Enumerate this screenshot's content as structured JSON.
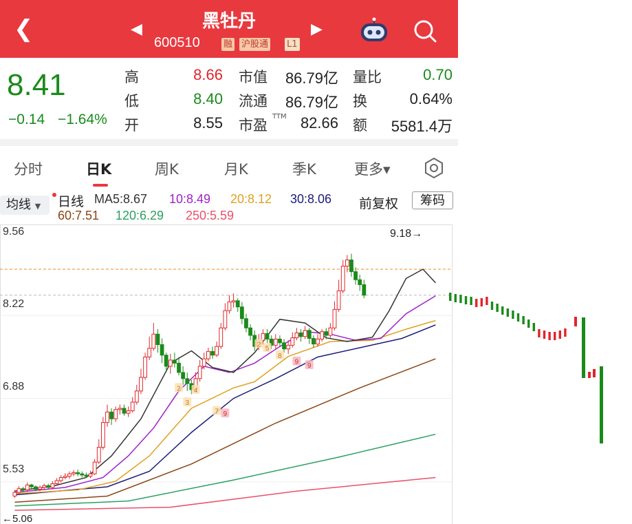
{
  "header": {
    "back_icon": "chevron-left-icon",
    "stock_name": "黑牡丹",
    "stock_code": "600510",
    "badges": [
      "融",
      "沪股通",
      "L1"
    ],
    "prev_icon": "triangle-left-icon",
    "next_icon": "triangle-right-icon",
    "assistant_icon": "robot-icon",
    "search_icon": "search-icon"
  },
  "quote": {
    "price": "8.41",
    "change": "−0.14",
    "change_pct": "−1.64%",
    "high_label": "高",
    "high": "8.66",
    "low_label": "低",
    "low": "8.40",
    "open_label": "开",
    "open": "8.55",
    "mktcap_label": "市值",
    "mktcap": "86.79亿",
    "float_label": "流通",
    "float": "86.79亿",
    "pe_label": "市盈",
    "pe_sup": "TTM",
    "pe": "82.66",
    "volratio_label": "量比",
    "volratio": "0.70",
    "turnover_label": "换",
    "turnover": "0.64%",
    "amount_label": "额",
    "amount": "5581.4万"
  },
  "tabs": [
    "分时",
    "日K",
    "周K",
    "月K",
    "季K",
    "更多▾"
  ],
  "active_tab": "日K",
  "settings_icon": "hexagon-gear-icon",
  "indicators": {
    "selector": "均线",
    "period": "日线",
    "ma5": "MA5:8.67",
    "ma10": "10:8.49",
    "ma20": "20:8.12",
    "ma30": "30:8.06",
    "ma60": "60:7.51",
    "ma120": "120:6.29",
    "ma250": "250:5.59",
    "adjust": "前复权",
    "chips_button": "筹码"
  },
  "colors": {
    "up": "#e0252a",
    "down": "#1a8a1a",
    "ma5": "#333333",
    "ma10": "#a020c8",
    "ma20": "#e0a020",
    "ma30": "#1b1b7a",
    "ma60": "#8b4513",
    "ma120": "#2aa060",
    "ma250": "#e8506a"
  },
  "chart_data": {
    "type": "candlestick",
    "y_ticks": [
      "9.56",
      "8.22",
      "6.88",
      "5.53"
    ],
    "ylim": [
      5.06,
      9.56
    ],
    "period_high": "9.18→",
    "period_low": "←5.06",
    "reference_lines": [
      8.97,
      8.55
    ],
    "candles": [
      [
        5.3,
        5.36,
        5.27,
        5.4
      ],
      [
        5.36,
        5.42,
        5.33,
        5.46
      ],
      [
        5.42,
        5.4,
        5.36,
        5.45
      ],
      [
        5.4,
        5.48,
        5.37,
        5.52
      ],
      [
        5.48,
        5.45,
        5.42,
        5.5
      ],
      [
        5.45,
        5.41,
        5.38,
        5.47
      ],
      [
        5.41,
        5.44,
        5.38,
        5.47
      ],
      [
        5.44,
        5.47,
        5.41,
        5.5
      ],
      [
        5.47,
        5.44,
        5.42,
        5.5
      ],
      [
        5.44,
        5.5,
        5.41,
        5.54
      ],
      [
        5.5,
        5.55,
        5.47,
        5.59
      ],
      [
        5.55,
        5.6,
        5.52,
        5.64
      ],
      [
        5.6,
        5.62,
        5.57,
        5.67
      ],
      [
        5.62,
        5.66,
        5.58,
        5.7
      ],
      [
        5.66,
        5.68,
        5.62,
        5.72
      ],
      [
        5.68,
        5.66,
        5.62,
        5.73
      ],
      [
        5.66,
        5.64,
        5.6,
        5.7
      ],
      [
        5.64,
        5.62,
        5.6,
        5.68
      ],
      [
        5.62,
        5.66,
        5.59,
        5.71
      ],
      [
        5.66,
        5.85,
        5.64,
        5.9
      ],
      [
        5.85,
        6.09,
        5.82,
        6.22
      ],
      [
        6.09,
        6.49,
        6.05,
        6.58
      ],
      [
        6.49,
        6.66,
        6.42,
        6.78
      ],
      [
        6.66,
        6.55,
        6.45,
        6.72
      ],
      [
        6.55,
        6.7,
        6.5,
        6.75
      ],
      [
        6.7,
        6.72,
        6.62,
        6.78
      ],
      [
        6.72,
        6.64,
        6.6,
        6.78
      ],
      [
        6.64,
        6.68,
        6.58,
        6.75
      ],
      [
        6.68,
        6.82,
        6.65,
        6.9
      ],
      [
        6.82,
        7.0,
        6.78,
        7.1
      ],
      [
        7.0,
        7.22,
        6.95,
        7.36
      ],
      [
        7.22,
        7.55,
        7.18,
        7.62
      ],
      [
        7.55,
        7.69,
        7.5,
        7.88
      ],
      [
        7.69,
        7.92,
        7.65,
        8.1
      ],
      [
        7.92,
        7.75,
        7.62,
        8.0
      ],
      [
        7.75,
        7.58,
        7.45,
        7.85
      ],
      [
        7.58,
        7.4,
        7.3,
        7.62
      ],
      [
        7.4,
        7.5,
        7.28,
        7.6
      ],
      [
        7.5,
        7.45,
        7.38,
        7.62
      ],
      [
        7.45,
        7.3,
        7.25,
        7.55
      ],
      [
        7.3,
        7.2,
        7.1,
        7.4
      ],
      [
        7.2,
        7.12,
        7.0,
        7.3
      ],
      [
        7.12,
        7.02,
        6.95,
        7.18
      ],
      [
        7.02,
        7.2,
        6.98,
        7.3
      ],
      [
        7.2,
        7.4,
        7.15,
        7.5
      ],
      [
        7.4,
        7.52,
        7.35,
        7.62
      ],
      [
        7.52,
        7.64,
        7.48,
        7.7
      ],
      [
        7.64,
        7.58,
        7.52,
        7.72
      ],
      [
        7.58,
        7.72,
        7.55,
        7.8
      ],
      [
        7.72,
        8.02,
        7.68,
        8.1
      ],
      [
        8.02,
        8.3,
        7.98,
        8.42
      ],
      [
        8.3,
        8.44,
        8.25,
        8.55
      ],
      [
        8.44,
        8.46,
        8.35,
        8.58
      ],
      [
        8.46,
        8.36,
        8.28,
        8.5
      ],
      [
        8.36,
        8.17,
        8.08,
        8.44
      ],
      [
        8.17,
        8.02,
        7.95,
        8.25
      ],
      [
        8.02,
        7.9,
        7.82,
        8.08
      ],
      [
        7.9,
        7.72,
        7.65,
        7.98
      ],
      [
        7.72,
        7.82,
        7.66,
        7.92
      ],
      [
        7.82,
        7.93,
        7.75,
        8.0
      ],
      [
        7.93,
        7.84,
        7.78,
        8.0
      ],
      [
        7.84,
        7.74,
        7.68,
        7.9
      ],
      [
        7.74,
        7.84,
        7.68,
        7.92
      ],
      [
        7.84,
        7.78,
        7.72,
        7.9
      ],
      [
        7.78,
        7.68,
        7.62,
        7.84
      ],
      [
        7.68,
        7.74,
        7.6,
        7.82
      ],
      [
        7.74,
        7.86,
        7.7,
        7.95
      ],
      [
        7.86,
        7.94,
        7.82,
        8.02
      ],
      [
        7.94,
        7.88,
        7.8,
        8.0
      ],
      [
        7.88,
        7.98,
        7.84,
        8.05
      ],
      [
        7.98,
        7.85,
        7.76,
        8.02
      ],
      [
        7.85,
        7.76,
        7.7,
        7.9
      ],
      [
        7.76,
        7.84,
        7.72,
        7.92
      ],
      [
        7.84,
        7.96,
        7.8,
        8.0
      ],
      [
        7.96,
        7.9,
        7.84,
        8.02
      ],
      [
        7.9,
        8.02,
        7.86,
        8.1
      ],
      [
        8.02,
        8.32,
        7.98,
        8.45
      ],
      [
        8.32,
        8.62,
        8.28,
        8.8
      ],
      [
        8.62,
        9.02,
        8.58,
        9.12
      ],
      [
        9.02,
        9.12,
        8.92,
        9.2
      ],
      [
        9.12,
        8.93,
        8.85,
        9.22
      ],
      [
        8.93,
        8.8,
        8.72,
        9.0
      ],
      [
        8.8,
        8.72,
        8.62,
        8.88
      ],
      [
        8.72,
        8.55,
        8.5,
        8.8
      ]
    ],
    "ma_series": [
      {
        "name": "MA5",
        "points": [
          [
            3,
            5.38
          ],
          [
            12,
            5.46
          ],
          [
            20,
            5.6
          ],
          [
            26,
            5.95
          ],
          [
            33,
            6.55
          ],
          [
            40,
            7.45
          ],
          [
            45,
            7.65
          ],
          [
            50,
            7.38
          ],
          [
            55,
            7.3
          ],
          [
            60,
            7.62
          ],
          [
            66,
            8.16
          ],
          [
            72,
            8.1
          ],
          [
            77,
            7.86
          ],
          [
            82,
            7.8
          ],
          [
            88,
            7.87
          ],
          [
            92,
            8.3
          ],
          [
            96,
            8.82
          ],
          [
            100,
            8.97
          ],
          [
            103,
            8.75
          ]
        ]
      },
      {
        "name": "MA10",
        "points": [
          [
            3,
            5.36
          ],
          [
            15,
            5.44
          ],
          [
            24,
            5.6
          ],
          [
            30,
            5.95
          ],
          [
            36,
            6.4
          ],
          [
            42,
            7.0
          ],
          [
            48,
            7.4
          ],
          [
            54,
            7.3
          ],
          [
            60,
            7.45
          ],
          [
            66,
            7.72
          ],
          [
            72,
            7.96
          ],
          [
            78,
            7.92
          ],
          [
            84,
            7.82
          ],
          [
            90,
            7.85
          ],
          [
            96,
            8.25
          ],
          [
            103,
            8.54
          ]
        ]
      },
      {
        "name": "MA20",
        "points": [
          [
            3,
            5.34
          ],
          [
            18,
            5.4
          ],
          [
            27,
            5.54
          ],
          [
            35,
            5.95
          ],
          [
            45,
            6.72
          ],
          [
            55,
            7.05
          ],
          [
            60,
            7.15
          ],
          [
            68,
            7.56
          ],
          [
            78,
            7.8
          ],
          [
            88,
            7.82
          ],
          [
            96,
            8.0
          ],
          [
            103,
            8.14
          ]
        ]
      },
      {
        "name": "MA30",
        "points": [
          [
            3,
            5.32
          ],
          [
            25,
            5.45
          ],
          [
            35,
            5.7
          ],
          [
            45,
            6.33
          ],
          [
            55,
            6.88
          ],
          [
            65,
            7.2
          ],
          [
            75,
            7.55
          ],
          [
            85,
            7.7
          ],
          [
            95,
            7.85
          ],
          [
            103,
            8.07
          ]
        ]
      },
      {
        "name": "MA60",
        "points": [
          [
            3,
            5.2
          ],
          [
            25,
            5.3
          ],
          [
            45,
            5.82
          ],
          [
            65,
            6.48
          ],
          [
            85,
            7.05
          ],
          [
            103,
            7.52
          ]
        ]
      },
      {
        "name": "MA120",
        "points": [
          [
            3,
            5.14
          ],
          [
            30,
            5.22
          ],
          [
            55,
            5.56
          ],
          [
            80,
            5.93
          ],
          [
            103,
            6.3
          ]
        ]
      },
      {
        "name": "MA250",
        "points": [
          [
            3,
            5.07
          ],
          [
            40,
            5.12
          ],
          [
            70,
            5.38
          ],
          [
            103,
            5.6
          ]
        ]
      }
    ],
    "markers": [
      [
        "2",
        42,
        7.05
      ],
      [
        "4",
        46,
        7.02
      ],
      [
        "3",
        44,
        6.82
      ],
      [
        "7",
        51,
        6.68
      ],
      [
        "9",
        53,
        6.64
      ],
      [
        "2",
        61,
        7.76
      ],
      [
        "5",
        63,
        7.7
      ],
      [
        "8",
        66,
        7.58
      ],
      [
        "9",
        70,
        7.48
      ],
      [
        "9",
        73,
        7.42
      ]
    ]
  }
}
